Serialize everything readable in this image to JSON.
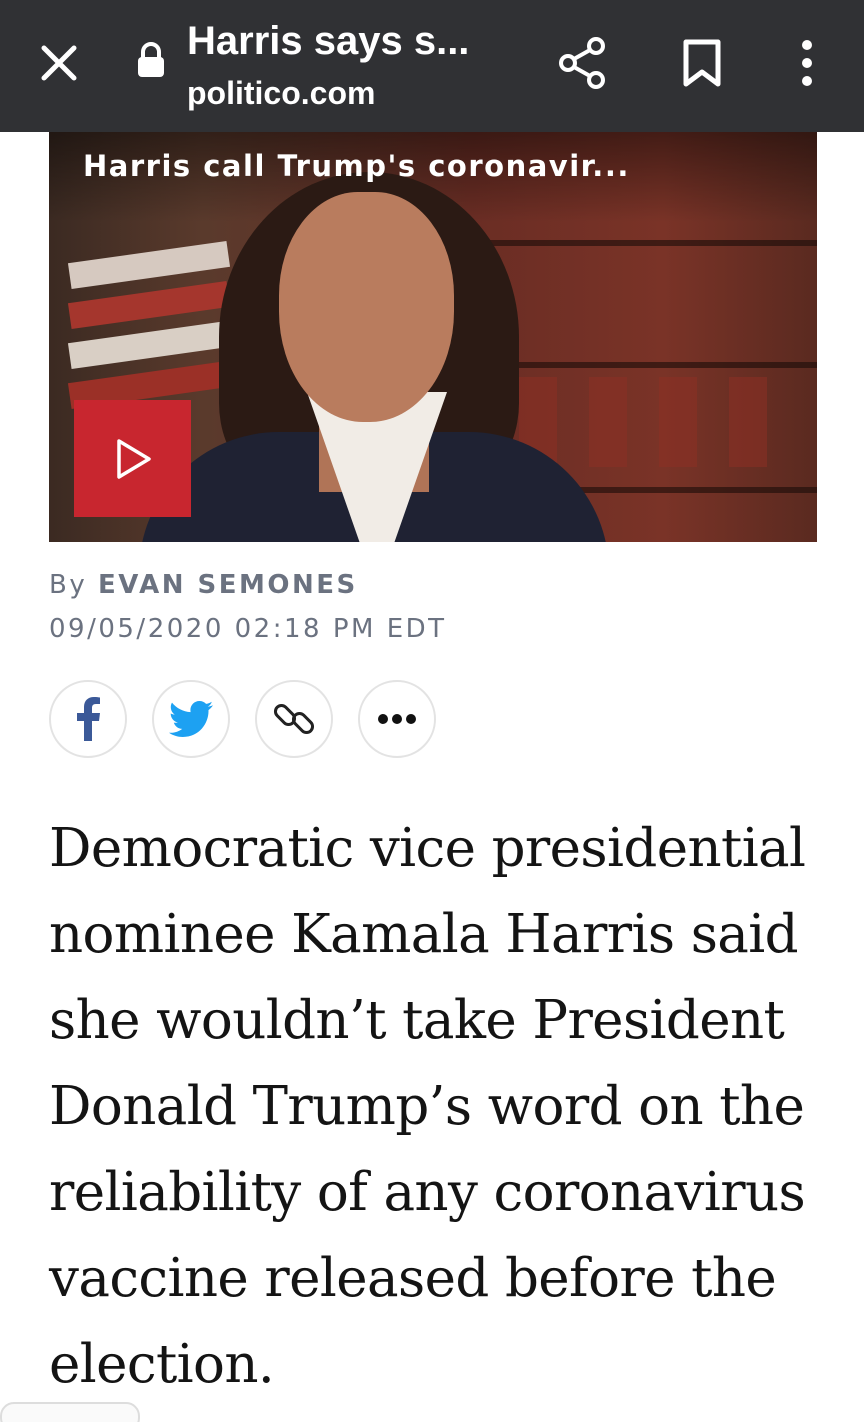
{
  "browser": {
    "tab_title": "Harris says s...",
    "domain": "politico.com"
  },
  "video": {
    "caption": "Harris call Trump's coronavir...",
    "accent_color": "#c8262f"
  },
  "byline": {
    "prefix": "By",
    "author": "EVAN SEMONES",
    "timestamp": "09/05/2020 02:18 PM EDT"
  },
  "share": {
    "buttons": [
      "facebook-icon",
      "twitter-icon",
      "link-icon",
      "more-icon"
    ]
  },
  "article": {
    "lead": "Democratic vice presidential nominee Kamala Harris said she wouldn’t take President Donald Trump’s word on the reliability of any coronavirus vaccine released before the election."
  }
}
